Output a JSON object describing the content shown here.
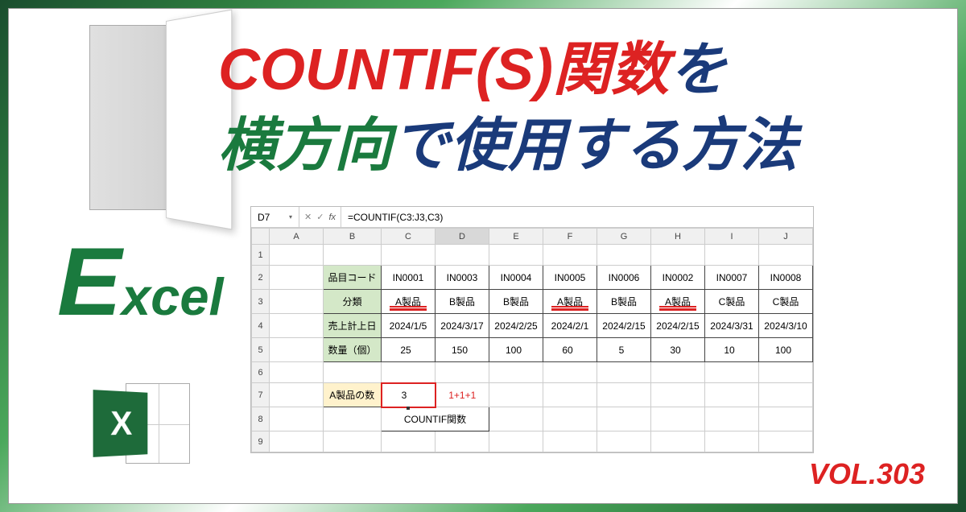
{
  "title": {
    "part1": "COUNTIF(S)関数",
    "part2": "を",
    "part3": "横方向",
    "part4": "で使用する方法"
  },
  "logo_text": {
    "e": "E",
    "rest": "xcel",
    "icon_x": "X"
  },
  "vol": "VOL.303",
  "formula_bar": {
    "name_box": "D7",
    "fx": "fx",
    "formula": "=COUNTIF(C3:J3,C3)"
  },
  "columns": [
    "A",
    "B",
    "C",
    "D",
    "E",
    "F",
    "G",
    "H",
    "I",
    "J"
  ],
  "rows": [
    "1",
    "2",
    "3",
    "4",
    "5",
    "6",
    "7",
    "8",
    "9"
  ],
  "labels": {
    "item_code": "品目コード",
    "category": "分類",
    "sales_date": "売上計上日",
    "quantity": "数量（個）",
    "a_count_label": "A製品の数",
    "countif_label": "COUNTIF関数",
    "formula_note": "1+1+1"
  },
  "data": {
    "item_code": [
      "IN0001",
      "IN0003",
      "IN0004",
      "IN0005",
      "IN0006",
      "IN0002",
      "IN0007",
      "IN0008"
    ],
    "category": [
      "A製品",
      "B製品",
      "B製品",
      "A製品",
      "B製品",
      "A製品",
      "C製品",
      "C製品"
    ],
    "sales_date": [
      "2024/1/5",
      "2024/3/17",
      "2024/2/25",
      "2024/2/1",
      "2024/2/15",
      "2024/2/15",
      "2024/3/31",
      "2024/3/10"
    ],
    "quantity": [
      "25",
      "150",
      "100",
      "60",
      "5",
      "30",
      "10",
      "100"
    ],
    "a_count_result": "3"
  },
  "underlined_category_indices": [
    0,
    3,
    5
  ]
}
